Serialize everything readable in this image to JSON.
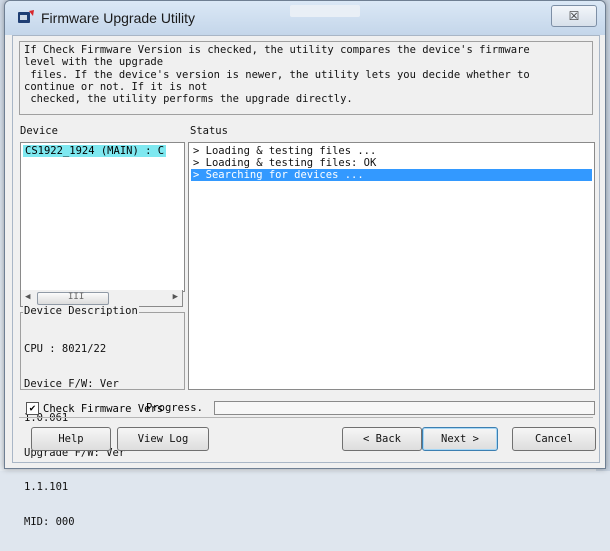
{
  "window": {
    "title": "Firmware Upgrade Utility",
    "close_glyph": "☒"
  },
  "intro_text": "If Check Firmware Version is checked, the utility compares the device's firmware\nlevel with the upgrade\n files. If the device's version is newer, the utility lets you decide whether to\ncontinue or not. If it is not\n checked, the utility performs the upgrade directly.",
  "labels": {
    "device": "Device",
    "status": "Status",
    "progress": "Progress."
  },
  "device_list": {
    "items": [
      "CS1922_1924 (MAIN) : C"
    ],
    "scroll_grip": "III"
  },
  "status_log": [
    "> Loading & testing files ...",
    "> Loading & testing files: OK",
    "> Searching for devices ..."
  ],
  "status_selected_index": 2,
  "device_description": {
    "legend": "Device Description",
    "lines": [
      "CPU : 8021/22",
      "Device F/W: Ver",
      "1.0.061",
      "Upgrade F/W: Ver",
      "1.1.101",
      "MID: 000"
    ]
  },
  "check_firmware": {
    "label": "Check Firmware Versi",
    "checked": true,
    "check_glyph": "✔"
  },
  "progress_value": 0,
  "buttons": {
    "help": "Help",
    "view_log": "View Log",
    "back": "< Back",
    "next": "Next >",
    "cancel": "Cancel"
  },
  "colors": {
    "selection": "#3399ff",
    "device_highlight": "#7ee8f0"
  }
}
